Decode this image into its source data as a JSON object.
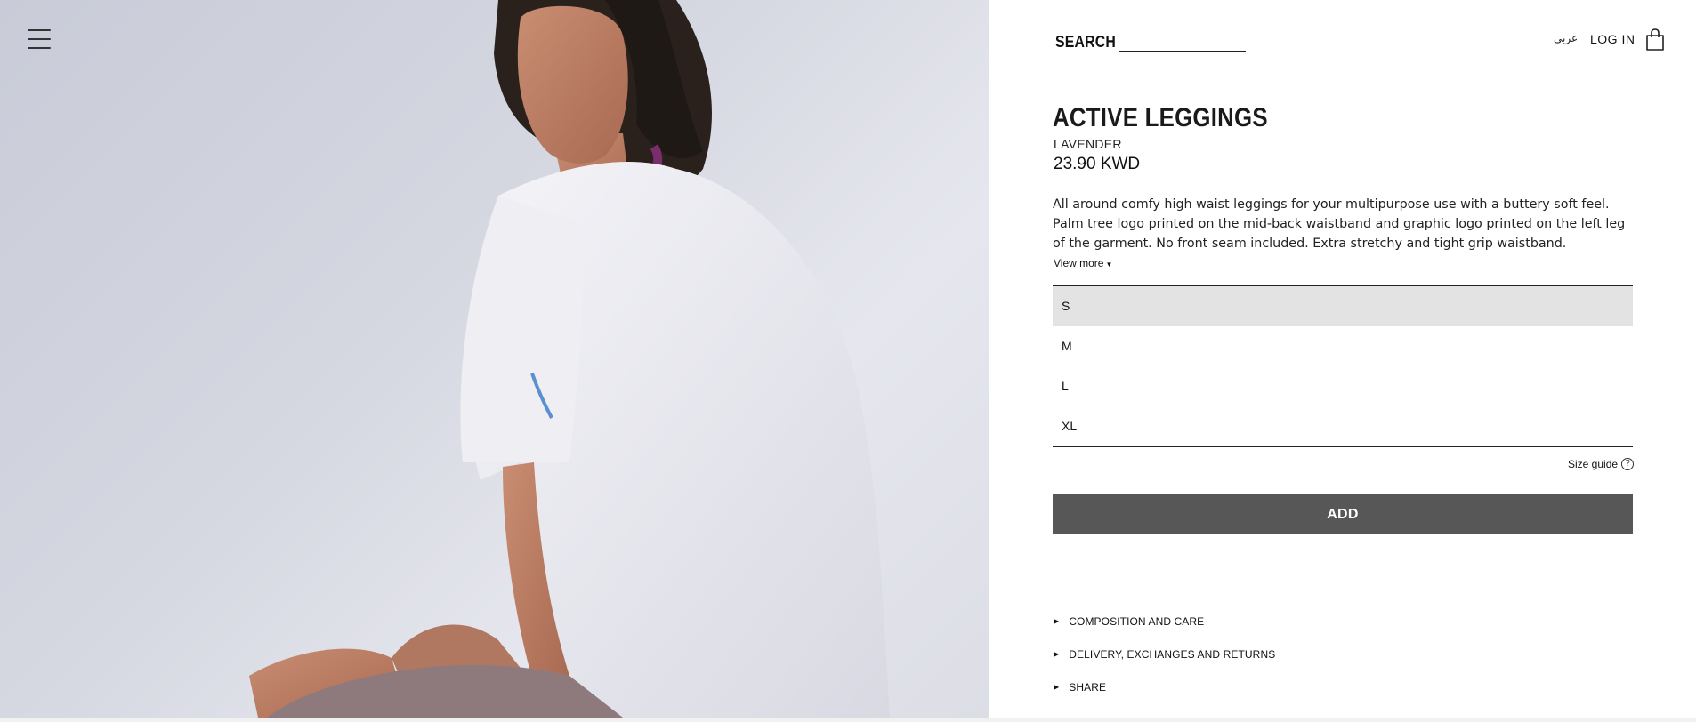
{
  "header": {
    "search_label": "SEARCH",
    "search_value": "",
    "language_link": "عربي",
    "login_label": "LOG IN"
  },
  "product": {
    "title": "ACTIVE LEGGINGS",
    "color": "LAVENDER",
    "price": "23.90 KWD",
    "description": "All around comfy high waist leggings for your multipurpose use with a buttery soft feel. Palm tree logo printed on the mid-back waistband and graphic logo printed on the left leg of the garment. No front seam included. Extra stretchy and tight grip waistband.",
    "view_more_label": "View more"
  },
  "sizes": {
    "options": [
      "S",
      "M",
      "L",
      "XL"
    ],
    "selected": "S"
  },
  "size_guide_label": "Size guide",
  "add_button_label": "ADD",
  "accordion": [
    "COMPOSITION AND CARE",
    "DELIVERY, EXCHANGES AND RETURNS",
    "SHARE"
  ],
  "colors": {
    "add_button_bg": "#575757",
    "selected_size_bg": "#e3e3e3"
  },
  "icons": {
    "menu": "hamburger-menu-icon",
    "bag": "shopping-bag-icon",
    "help": "question-circle-icon"
  }
}
